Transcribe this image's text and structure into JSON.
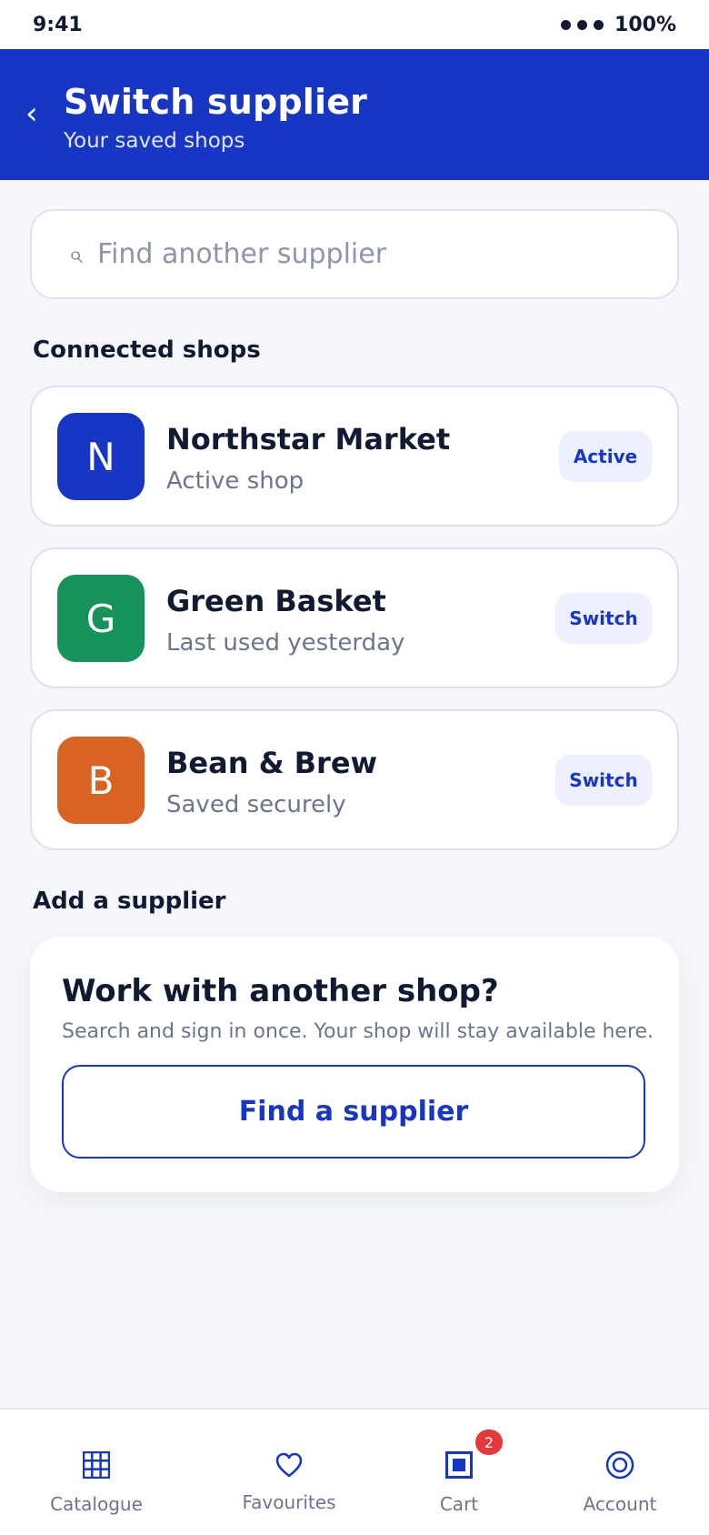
{
  "status_bar": {
    "time": "9:41",
    "battery": "100%"
  },
  "header": {
    "back_icon": "chevron-left-icon",
    "back_glyph": "‹",
    "title": "Switch supplier",
    "subtitle": "Your saved shops"
  },
  "search": {
    "icon": "search-icon",
    "glyph": "⌕",
    "placeholder": "Find another supplier",
    "value": ""
  },
  "connected_section": {
    "heading": "Connected shops",
    "shops": [
      {
        "initial": "N",
        "name": "Northstar Market",
        "status": "Active shop",
        "action": "Active",
        "color": "#1836c4"
      },
      {
        "initial": "G",
        "name": "Green Basket",
        "status": "Last used yesterday",
        "action": "Switch",
        "color": "#16935a"
      },
      {
        "initial": "B",
        "name": "Bean & Brew",
        "status": "Saved securely",
        "action": "Switch",
        "color": "#d96322"
      }
    ]
  },
  "add_section": {
    "heading": "Add a supplier",
    "card_title": "Work with another shop?",
    "card_description": "Search and sign in once. Your shop will stay available here.",
    "button_label": "Find a supplier"
  },
  "bottom_nav": {
    "items": [
      {
        "label": "Catalogue",
        "icon": "grid-icon"
      },
      {
        "label": "Favourites",
        "icon": "heart-icon"
      },
      {
        "label": "Cart",
        "icon": "cart-icon",
        "badge": "2"
      },
      {
        "label": "Account",
        "icon": "account-icon"
      }
    ]
  },
  "colors": {
    "brand": "#1836c4",
    "background": "#f5f7fb",
    "badge": "#e5393b"
  }
}
